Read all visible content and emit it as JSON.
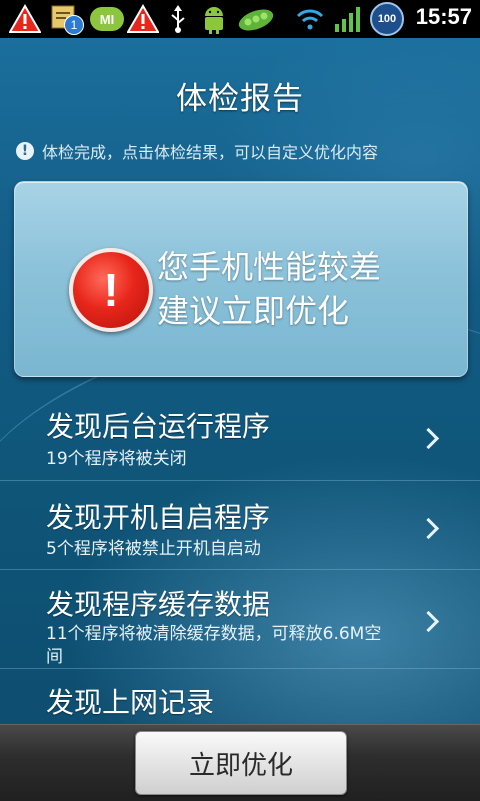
{
  "status_bar": {
    "time": "15:57",
    "battery": "100",
    "icons": [
      "warning-icon",
      "notes-icon",
      "mi-talk-icon",
      "warning-icon",
      "usb-icon",
      "android-icon",
      "pea-icon",
      "wifi-icon",
      "signal-icon",
      "battery-icon"
    ],
    "badge_count": "1",
    "mi_label": "MI",
    "colors": {
      "warning": "#e8261b",
      "android": "#8cc63f",
      "wifi": "#36a9e1",
      "signal": "#5fc44a"
    }
  },
  "header": {
    "title": "体检报告"
  },
  "notice": {
    "icon": "info-icon",
    "text": "体检完成，点击体检结果，可以自定义优化内容"
  },
  "summary_card": {
    "icon": "alert-icon",
    "icon_glyph": "!",
    "line1": "您手机性能较差",
    "line2": "建议立即优化"
  },
  "results": [
    {
      "title": "发现后台运行程序",
      "subtitle": "19个程序将被关闭"
    },
    {
      "title": "发现开机自启程序",
      "subtitle": "5个程序将被禁止开机自启动"
    },
    {
      "title": "发现程序缓存数据",
      "subtitle": "11个程序将被清除缓存数据，可释放6.6M空间"
    },
    {
      "title": "发现上网记录",
      "subtitle": ""
    }
  ],
  "footer": {
    "optimize_button": "立即优化"
  },
  "colors": {
    "accent": "#135c86",
    "card": "#8cc2da",
    "alert": "#e8261b"
  }
}
